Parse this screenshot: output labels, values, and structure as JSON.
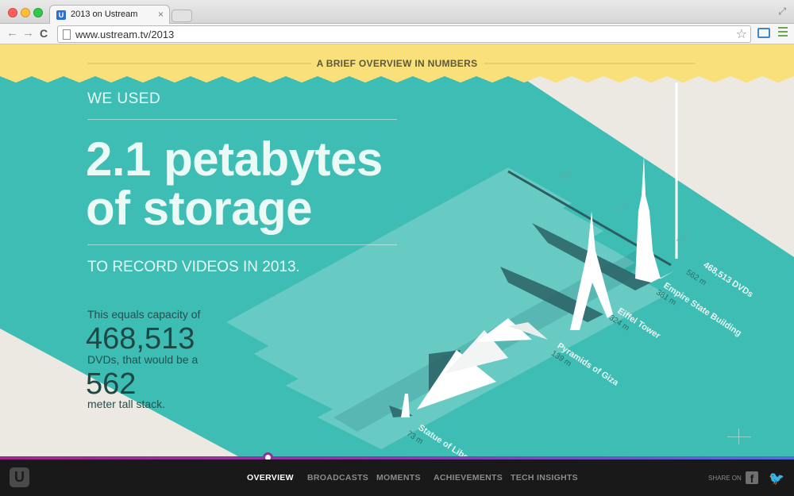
{
  "browser": {
    "tab_title": "2013 on Ustream",
    "tab_favicon": "U",
    "url": "www.ustream.tv/2013",
    "back_icon": "←",
    "forward_icon": "→",
    "reload_icon": "C",
    "star_icon": "☆",
    "close_icon": "×",
    "fullscreen_icon": "⤢"
  },
  "banner": {
    "text": "A BRIEF OVERVIEW IN NUMBERS"
  },
  "main": {
    "intro": "WE USED",
    "headline_line1": "2.1 petabytes",
    "headline_line2": "of storage",
    "sub": "TO RECORD VIDEOS IN 2013.",
    "stat_text1": "This equals capacity of",
    "stat_num1": "468,513",
    "stat_text2": "DVDs, that would be a",
    "stat_num2": "562",
    "stat_text3": "meter tall stack."
  },
  "chart_data": {
    "type": "bar",
    "categories": [
      "Statue of Liberty",
      "Pyramids of Giza",
      "Eiffel Tower",
      "Empire State Building",
      "468,513 DVDs"
    ],
    "values": [
      93,
      139,
      324,
      381,
      562
    ],
    "labels": [
      "73 m",
      "139 m",
      "324 m",
      "381 m",
      "562 m"
    ],
    "axis_ticks": [
      "100",
      "300",
      "500"
    ]
  },
  "footer": {
    "logo": "U",
    "nav": [
      "OVERVIEW",
      "BROADCASTS",
      "MOMENTS",
      "ACHIEVEMENTS",
      "TECH INSIGHTS"
    ],
    "active": "OVERVIEW",
    "share_label": "SHARE ON",
    "facebook_icon": "f",
    "twitter_icon": "🐦"
  },
  "colors": {
    "teal": "#3dbdb3",
    "banner_yellow": "#f9e07a",
    "cream": "#ece9e2",
    "footer": "#191919",
    "accent_purple": "#8d2f9f"
  }
}
